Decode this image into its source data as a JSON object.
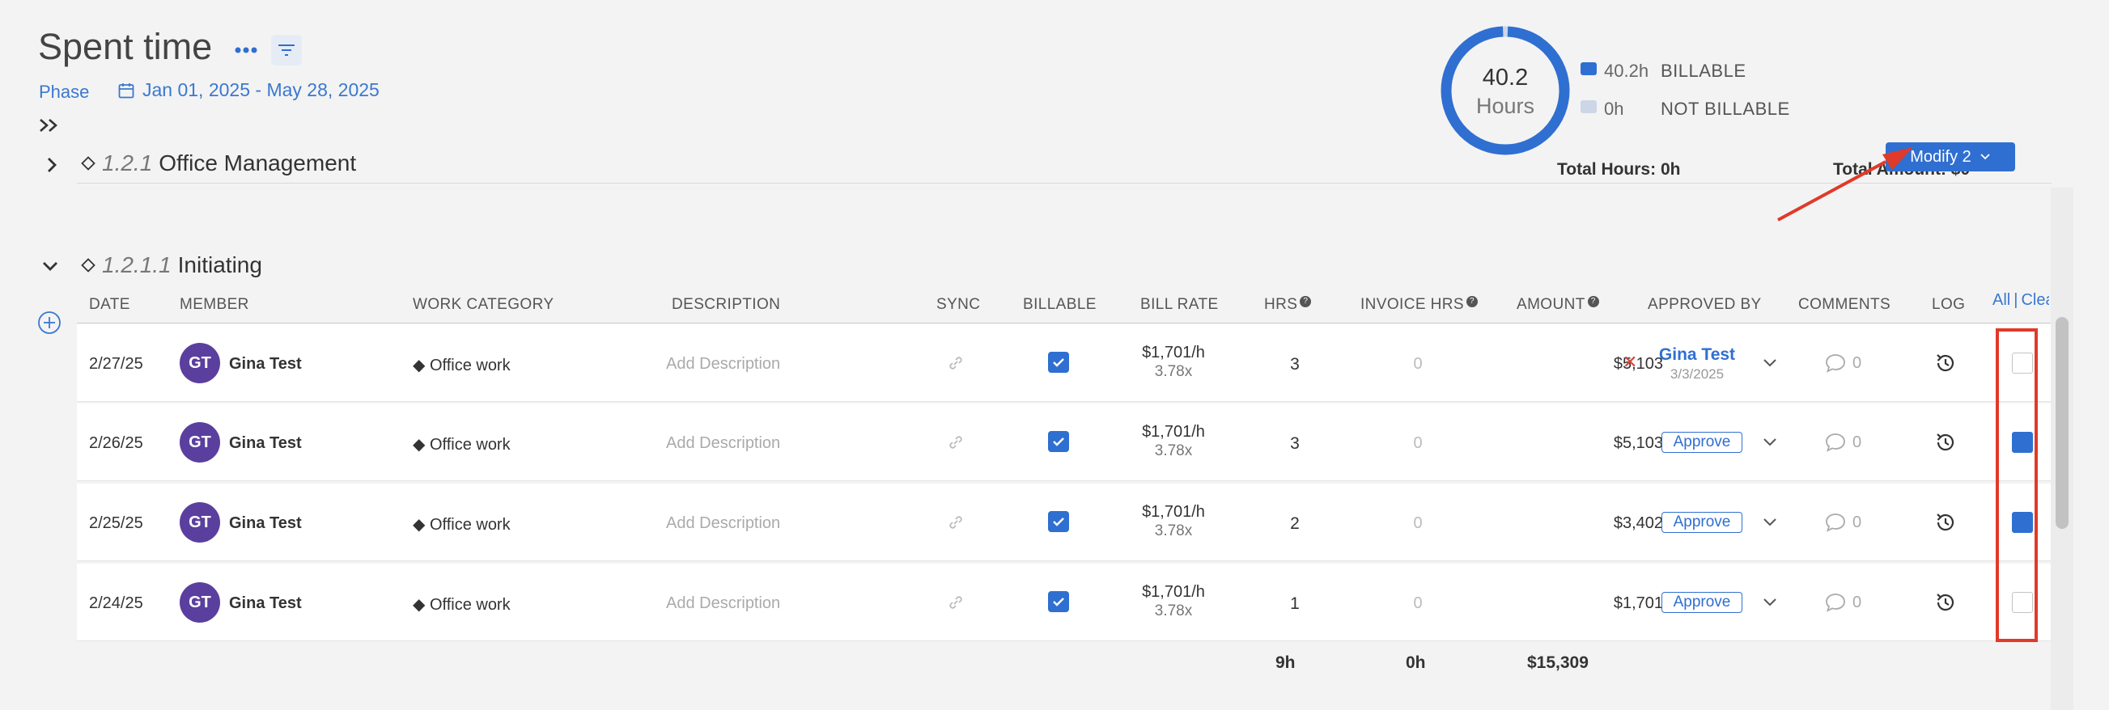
{
  "header": {
    "title": "Spent time",
    "phase_label": "Phase",
    "date_range": "Jan 01, 2025 - May 28, 2025"
  },
  "summary": {
    "hours_value": "40.2",
    "hours_unit": "Hours",
    "billable_fraction": 1.0,
    "legend": [
      {
        "value": "40.2h",
        "label": "BILLABLE",
        "color": "#2f6fd1"
      },
      {
        "value": "0h",
        "label": "NOT BILLABLE",
        "color": "#cdd6e6"
      }
    ]
  },
  "phase": {
    "number": "1.2.1",
    "name": "Office Management",
    "total_hours": "Total Hours: 0h",
    "total_amount": "Total Amount: $0",
    "modify_label": "Modify 2"
  },
  "subphase": {
    "number": "1.2.1.1",
    "name": "Initiating"
  },
  "table": {
    "headers": {
      "date": "DATE",
      "member": "MEMBER",
      "work_category": "WORK CATEGORY",
      "description": "DESCRIPTION",
      "sync": "SYNC",
      "billable": "BILLABLE",
      "bill_rate": "BILL RATE",
      "hrs": "HRS",
      "invoice_hrs": "INVOICE HRS",
      "amount": "AMOUNT",
      "approved_by": "APPROVED BY",
      "comments": "COMMENTS",
      "log": "LOG",
      "select_all": "All",
      "clear": "Clear"
    },
    "rows": [
      {
        "date": "2/27/25",
        "initials": "GT",
        "member": "Gina Test",
        "work_category": "Office work",
        "description_placeholder": "Add Description",
        "bill_rate": "$1,701/h",
        "multiplier": "3.78x",
        "hrs": "3",
        "invoice_hrs": "0",
        "amount": "$5,103",
        "approved": true,
        "approver": "Gina Test",
        "approved_date": "3/3/2025",
        "comments": "0",
        "selected": false
      },
      {
        "date": "2/26/25",
        "initials": "GT",
        "member": "Gina Test",
        "work_category": "Office work",
        "description_placeholder": "Add Description",
        "bill_rate": "$1,701/h",
        "multiplier": "3.78x",
        "hrs": "3",
        "invoice_hrs": "0",
        "amount": "$5,103",
        "approved": false,
        "approve_label": "Approve",
        "comments": "0",
        "selected": true
      },
      {
        "date": "2/25/25",
        "initials": "GT",
        "member": "Gina Test",
        "work_category": "Office work",
        "description_placeholder": "Add Description",
        "bill_rate": "$1,701/h",
        "multiplier": "3.78x",
        "hrs": "2",
        "invoice_hrs": "0",
        "amount": "$3,402",
        "approved": false,
        "approve_label": "Approve",
        "comments": "0",
        "selected": true
      },
      {
        "date": "2/24/25",
        "initials": "GT",
        "member": "Gina Test",
        "work_category": "Office work",
        "description_placeholder": "Add Description",
        "bill_rate": "$1,701/h",
        "multiplier": "3.78x",
        "hrs": "1",
        "invoice_hrs": "0",
        "amount": "$1,701",
        "approved": false,
        "approve_label": "Approve",
        "comments": "0",
        "selected": false
      }
    ],
    "totals": {
      "hrs": "9h",
      "invoice_hrs": "0h",
      "amount": "$15,309"
    }
  },
  "colors": {
    "accent": "#2f6fd1",
    "avatar": "#5a3f9e",
    "annotation": "#e03a2a"
  },
  "icons": {
    "more": "more-horizontal-icon",
    "filter": "filter-icon",
    "calendar": "calendar-icon",
    "sync": "link-icon",
    "comment": "speech-bubble-icon",
    "log": "history-icon"
  }
}
